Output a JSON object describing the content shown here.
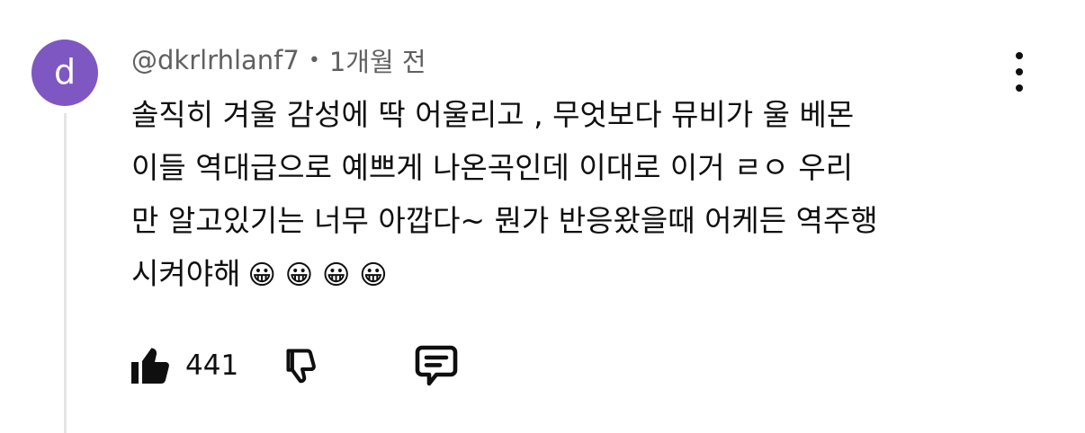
{
  "comment": {
    "avatar_letter": "d",
    "avatar_color": "#7e57c2",
    "author": "@dkrlrhlanf7",
    "separator": "•",
    "time": "1개월 전",
    "lines": [
      "솔직히 겨울 감성에 딱 어울리고 , 무엇보다 뮤비가 울 베몬",
      "이들 역대급으로 예쁘게 나온곡인데 이대로 이거 ㄹㅇ 우리",
      "만 알고있기는 너무 아깝다~ 뭔가 반응왔을때 어케든 역주행",
      "시켜야해"
    ],
    "emojis": "😀😀😀😀",
    "likes": "441"
  },
  "icons": {
    "menu": "more-vert-icon",
    "like": "thumbs-up-filled-icon",
    "dislike": "thumbs-down-outline-icon",
    "reply": "reply-comment-icon"
  }
}
